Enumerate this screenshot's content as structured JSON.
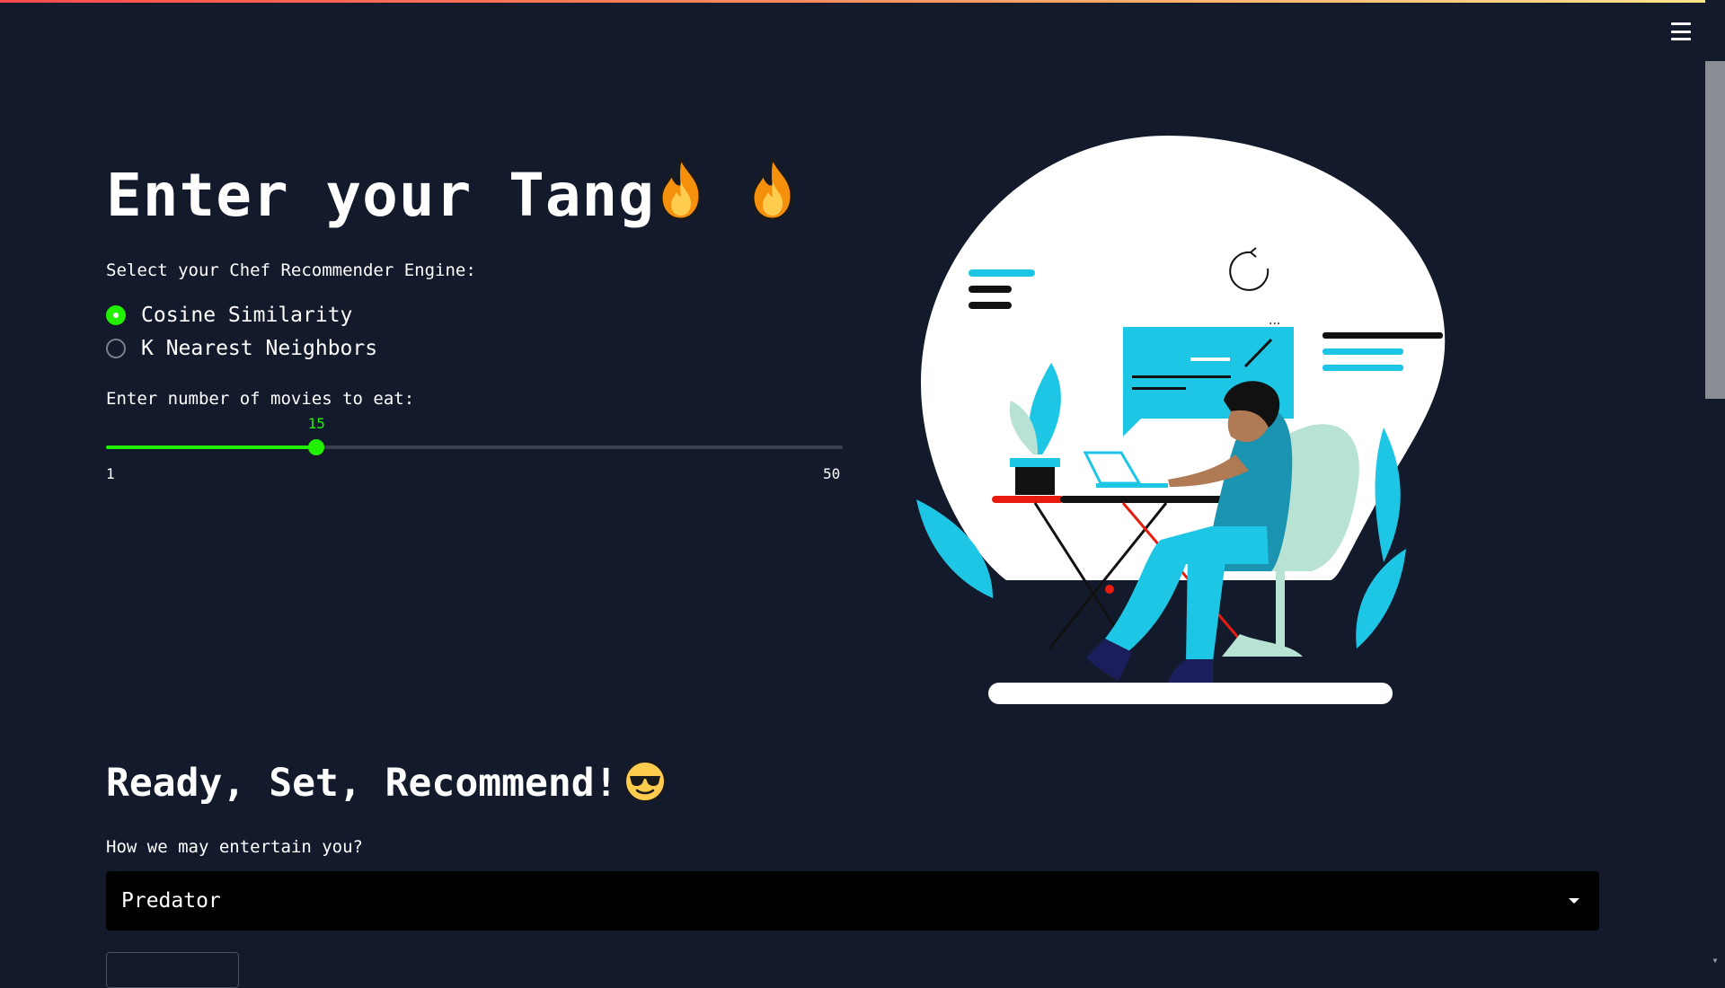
{
  "title": "Enter your Tang",
  "engine": {
    "label": "Select your Chef Recommender Engine:",
    "options": [
      "Cosine Similarity",
      "K Nearest Neighbors"
    ],
    "selected": "Cosine Similarity"
  },
  "slider": {
    "label": "Enter number of movies to eat:",
    "value": 15,
    "min": 1,
    "max": 50,
    "value_text": "15",
    "min_text": "1",
    "max_text": "50"
  },
  "section": {
    "heading": "Ready, Set, Recommend!"
  },
  "movie_select": {
    "label": "How we may entertain you?",
    "value": "Predator"
  },
  "colors": {
    "accent": "#21f000",
    "background": "#131a2c",
    "select_bg": "#000000"
  },
  "icons": [
    "fire-emoji-icon",
    "cool-sunglasses-emoji-icon",
    "hamburger-menu-icon",
    "chevron-down-icon"
  ]
}
